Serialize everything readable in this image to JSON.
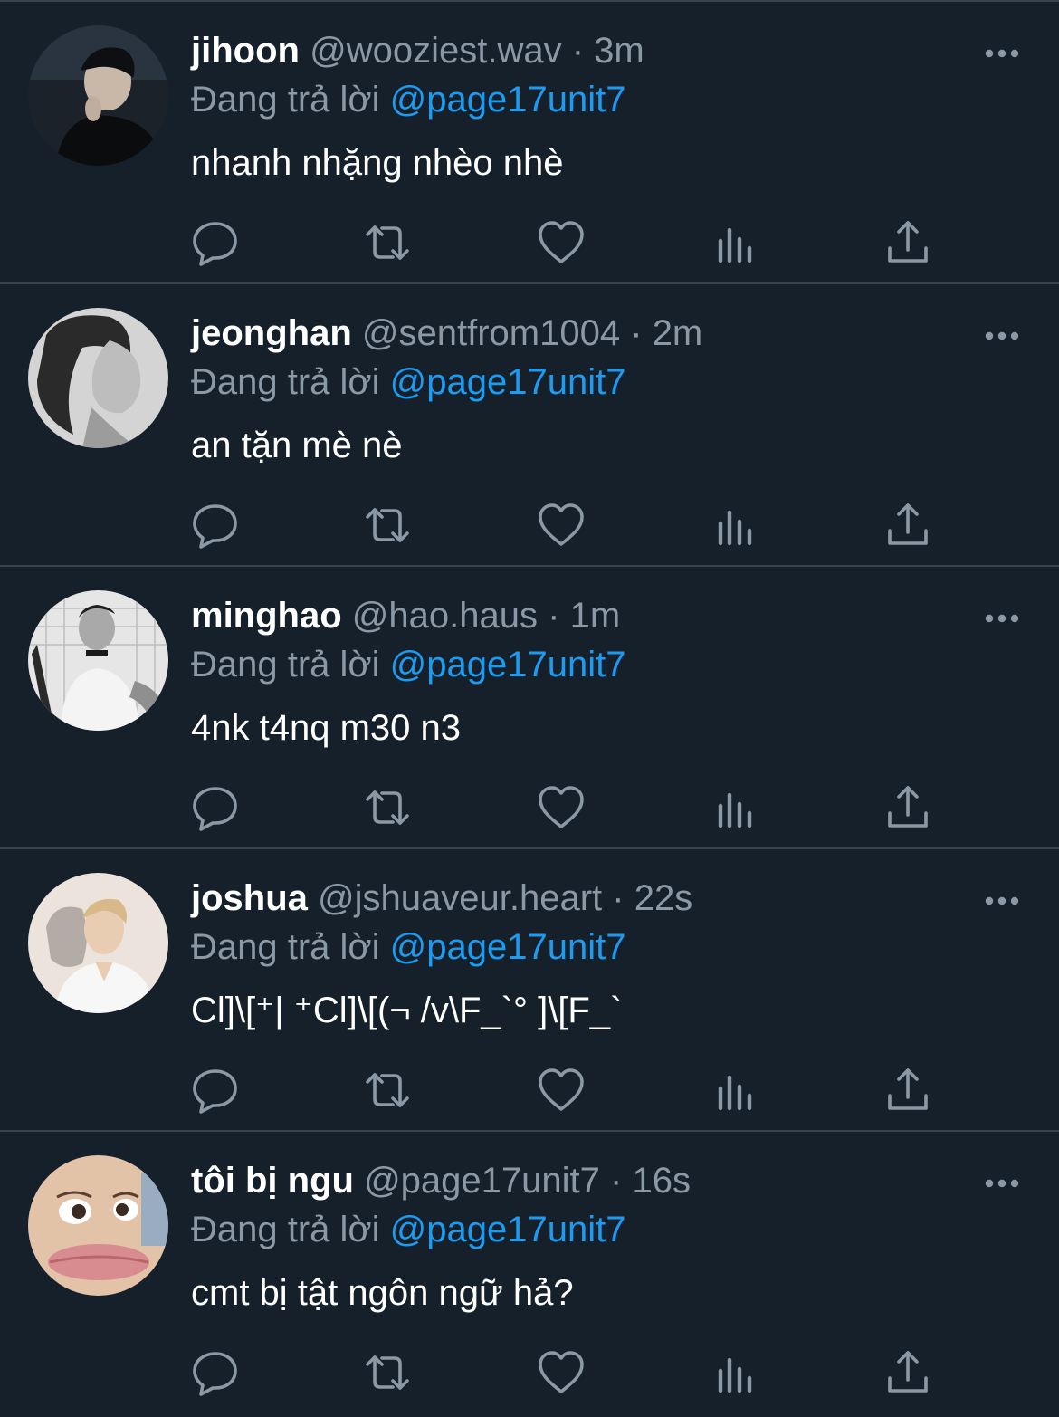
{
  "labels": {
    "replying_to_prefix": "Đang trả lời"
  },
  "colors": {
    "background": "#15202b",
    "divider": "#38444d",
    "secondary_text": "#8b98a5",
    "accent": "#1d9bf0"
  },
  "icons": {
    "more": "more-horizontal-icon",
    "reply": "comment-bubble-icon",
    "retweet": "retweet-arrows-icon",
    "like": "heart-icon",
    "views": "bar-chart-icon",
    "share": "share-upload-icon"
  },
  "tweets": [
    {
      "display_name": "jihoon",
      "handle": "@wooziest.wav",
      "separator": "·",
      "time": "3m",
      "reply_to": "@page17unit7",
      "text": "nhanh nhặng nhèo nhè"
    },
    {
      "display_name": "jeonghan",
      "handle": "@sentfrom1004",
      "separator": "·",
      "time": "2m",
      "reply_to": "@page17unit7",
      "text": "an tặn mè nè"
    },
    {
      "display_name": "minghao",
      "handle": "@hao.haus",
      "separator": "·",
      "time": "1m",
      "reply_to": "@page17unit7",
      "text": "4nk t4nq m30 n3"
    },
    {
      "display_name": "joshua",
      "handle": "@jshuaveur.heart",
      "separator": "·",
      "time": "22s",
      "reply_to": "@page17unit7",
      "text": "Cl]\\[⁺| ⁺Cl]\\[(¬ /v\\F_`° ]\\[F_`"
    },
    {
      "display_name": "tôi bị ngu",
      "handle": "@page17unit7",
      "separator": "·",
      "time": "16s",
      "reply_to": "@page17unit7",
      "text": "cmt bị tật ngôn ngữ hả?"
    }
  ]
}
